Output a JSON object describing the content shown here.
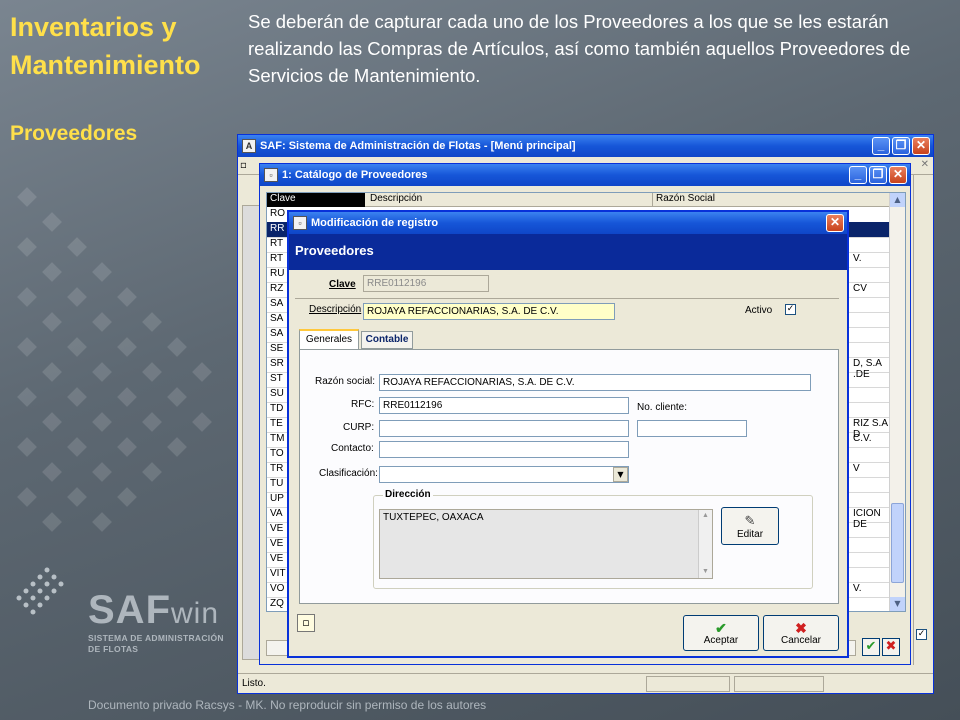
{
  "slide": {
    "title_line1": "Inventarios y",
    "title_line2": "Mantenimiento",
    "subtitle": "Proveedores",
    "intro": "Se deberán de capturar cada uno de los Proveedores a los que se les estarán realizando las Compras de Artículos, así como también aquellos Proveedores de Servicios de Mantenimiento.",
    "logo_big": "SAF",
    "logo_win": "win",
    "logo_line1": "SISTEMA DE ADMINISTRACIÓN",
    "logo_line2": "DE FLOTAS",
    "footer": "Documento privado Racsys - MK. No reproducir sin permiso de los autores"
  },
  "main_window": {
    "title": "SAF: Sistema de Administración de Flotas - [Menú principal]",
    "status": "Listo."
  },
  "catalog_window": {
    "title": "1: Catálogo de Proveedores",
    "columns": [
      "Clave",
      "Descripción",
      "Razón Social"
    ],
    "rows": [
      {
        "clave": "RO",
        "razon": ""
      },
      {
        "clave": "RR",
        "razon": ""
      },
      {
        "clave": "RT",
        "razon": ""
      },
      {
        "clave": "RT",
        "razon": "V."
      },
      {
        "clave": "RU",
        "razon": ""
      },
      {
        "clave": "RZ",
        "razon": "CV"
      },
      {
        "clave": "SA",
        "razon": ""
      },
      {
        "clave": "SA",
        "razon": ""
      },
      {
        "clave": "SA",
        "razon": ""
      },
      {
        "clave": "SE",
        "razon": ""
      },
      {
        "clave": "SR",
        "razon": "D, S.A .DE"
      },
      {
        "clave": "ST",
        "razon": ""
      },
      {
        "clave": "SU",
        "razon": ""
      },
      {
        "clave": "TD",
        "razon": ""
      },
      {
        "clave": "TE",
        "razon": "RIZ S.A D"
      },
      {
        "clave": "TM",
        "razon": "C.V."
      },
      {
        "clave": "TO",
        "razon": ""
      },
      {
        "clave": "TR",
        "razon": "V"
      },
      {
        "clave": "TU",
        "razon": ""
      },
      {
        "clave": "UP",
        "razon": ""
      },
      {
        "clave": "VA",
        "razon": "ICION DE"
      },
      {
        "clave": "VE",
        "razon": ""
      },
      {
        "clave": "VE",
        "razon": ""
      },
      {
        "clave": "VE",
        "razon": ""
      },
      {
        "clave": "VIT",
        "razon": ""
      },
      {
        "clave": "VO",
        "razon": "V."
      },
      {
        "clave": "ZQ",
        "razon": ""
      }
    ]
  },
  "dialog": {
    "title": "Modificación de registro",
    "header": "Proveedores",
    "clave_label": "Clave",
    "clave_value": "RRE0112196",
    "descripcion_label": "Descripción",
    "descripcion_value": "ROJAYA REFACCIONARIAS, S.A. DE C.V.",
    "activo_label": "Activo",
    "activo_checked": "✓",
    "tabs": [
      "Generales",
      "Contable"
    ],
    "razon_label": "Razón social:",
    "razon_value": "ROJAYA REFACCIONARIAS, S.A. DE C.V.",
    "rfc_label": "RFC:",
    "rfc_value": "RRE0112196",
    "nocliente_label": "No. cliente:",
    "nocliente_value": "",
    "curp_label": "CURP:",
    "curp_value": "",
    "contacto_label": "Contacto:",
    "contacto_value": "",
    "clasificacion_label": "Clasificación:",
    "clasificacion_value": "",
    "direccion_group": "Dirección",
    "direccion_value": "TUXTEPEC, OAXACA",
    "editar_label": "Editar",
    "aceptar_label": "Aceptar",
    "cancelar_label": "Cancelar"
  }
}
